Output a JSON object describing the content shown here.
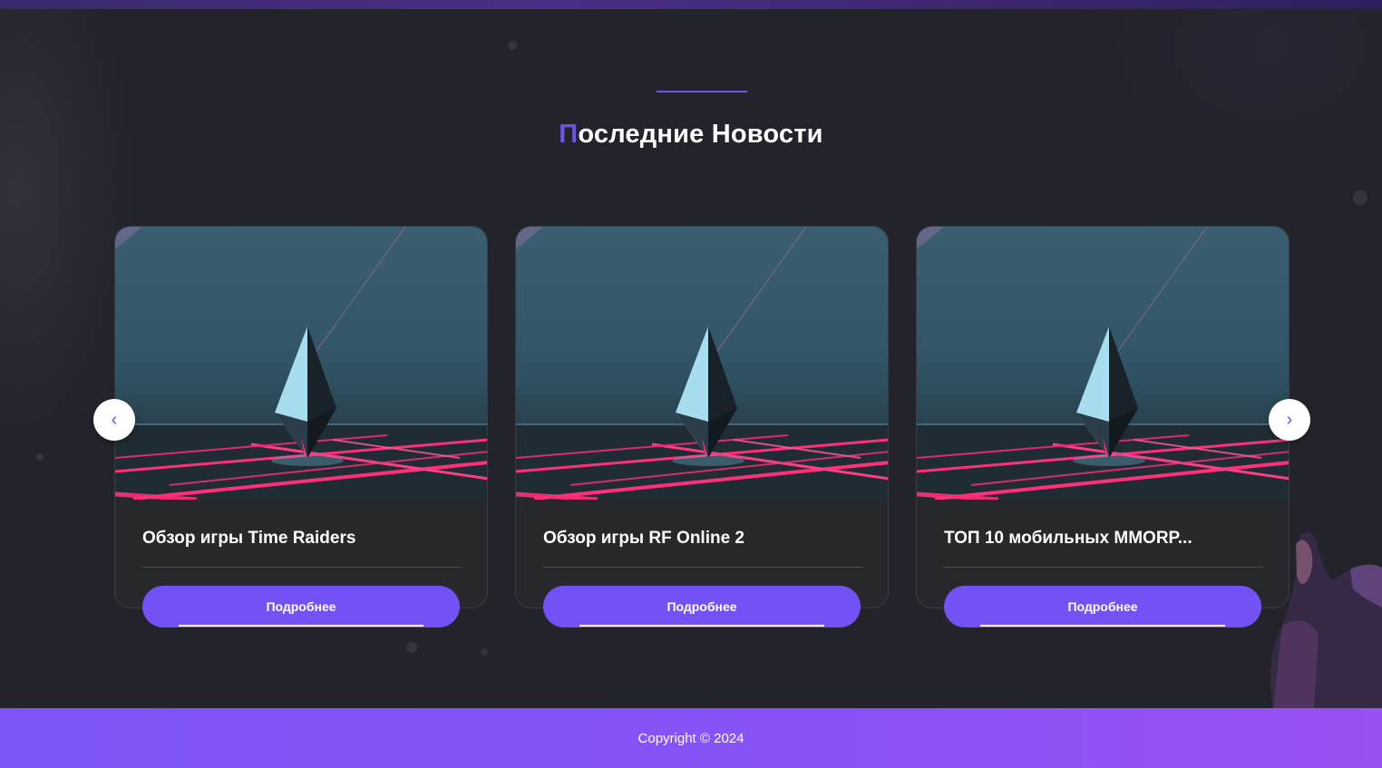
{
  "section": {
    "title_accent": "П",
    "title_rest": "оследние Новости"
  },
  "news": [
    {
      "title": "Обзор игры Time Raiders",
      "button_label": "Подробнее"
    },
    {
      "title": "Обзор игры RF Online 2",
      "button_label": "Подробнее"
    },
    {
      "title": "ТОП 10 мобильных MMORP...",
      "button_label": "Подробнее"
    }
  ],
  "carousel": {
    "prev_icon": "‹",
    "next_icon": "›"
  },
  "footer": {
    "copyright": "Copyright © 2024"
  },
  "colors": {
    "accent": "#6b55e8",
    "button": "#7451f5",
    "background": "#23232b",
    "footer_start": "#7d55f6",
    "footer_end": "#9a50f3"
  }
}
